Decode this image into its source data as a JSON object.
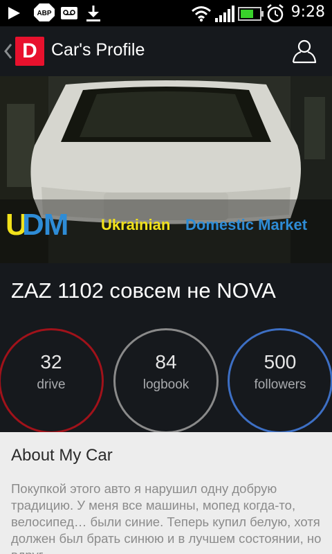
{
  "status_bar": {
    "time": "9:28",
    "icons": [
      "play-icon",
      "adblock-plus-icon",
      "voicemail-icon",
      "download-icon",
      "wifi-icon",
      "signal-icon",
      "battery-icon",
      "alarm-icon"
    ],
    "adblock_label": "ABP"
  },
  "action_bar": {
    "logo_letter": "D",
    "title": "Car's Profile",
    "logo_color": "#e8112d"
  },
  "banner": {
    "logo_u": "U",
    "logo_dm": "DM",
    "tagline_part1": "Ukrainian",
    "tagline_part2": "Domestic Market",
    "colors": {
      "yellow": "#f2e21b",
      "blue": "#2e8cd6"
    }
  },
  "car": {
    "name": "ZAZ 1102 совсем не NOVA"
  },
  "stats": [
    {
      "value": "32",
      "label": "drive",
      "color": "#a0121a"
    },
    {
      "value": "84",
      "label": "logbook",
      "color": "#8a8a8a"
    },
    {
      "value": "500",
      "label": "followers",
      "color": "#3d6fc4"
    }
  ],
  "about": {
    "title": "About My Car",
    "text": "Покупкой этого авто я нарушил одну добрую традицию. У меня все машины, мопед когда-то, велосипед… были синие. Теперь купил белую, хотя должен был брать синюю и в лучшем состоянии, но вдруг"
  }
}
